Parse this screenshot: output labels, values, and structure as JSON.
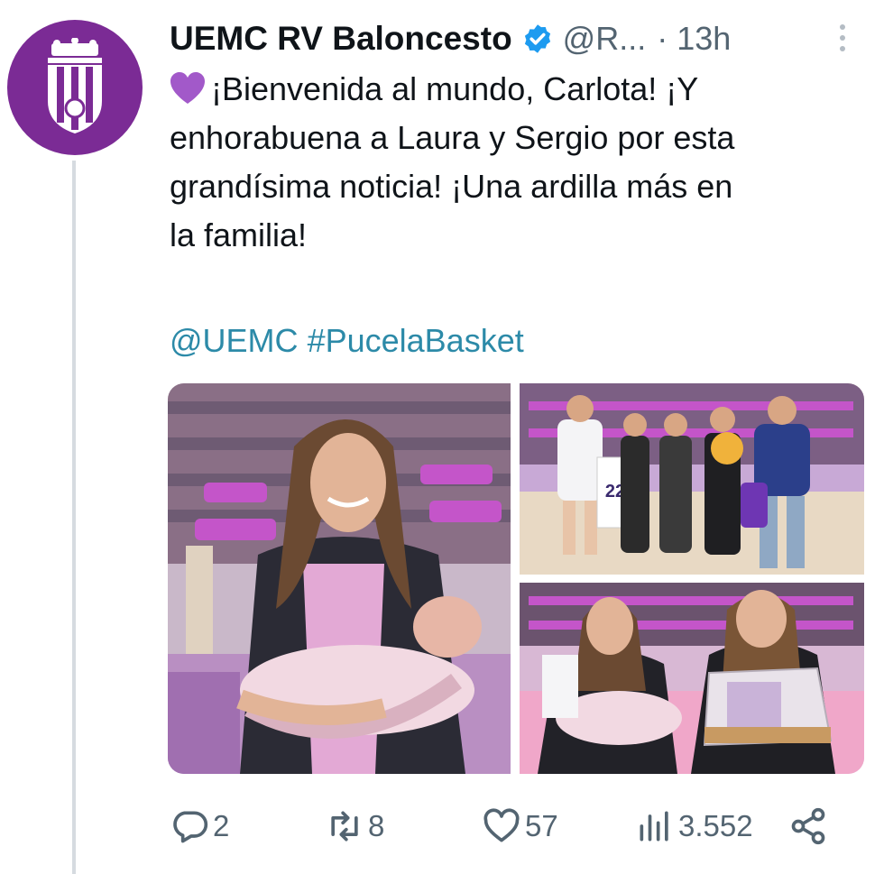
{
  "account": {
    "name": "UEMC RV Baloncesto",
    "handle": "@R...",
    "time": "· 13h"
  },
  "tweet": {
    "emoji": "purple-heart",
    "line1": "¡Bienvenida al mundo, Carlota! ¡Y",
    "line2": "enhorabuena a Laura y Sergio por esta",
    "line3": "grandísima noticia! ¡Una ardilla más en",
    "line4": "la familia!",
    "mention": "@UEMC",
    "hashtag": "#PucelaBasket"
  },
  "stats": {
    "replies": "2",
    "retweets": "8",
    "likes": "57",
    "views": "3.552"
  },
  "photos": {
    "jersey_number": "22"
  },
  "colors": {
    "brand_purple": "#7b2b95",
    "link": "#2c8aa8",
    "muted": "#536471",
    "verified": "#1d9bf0"
  },
  "icons": [
    "club-crest-icon",
    "verified-badge-icon",
    "more-icon",
    "purple-heart-icon",
    "reply-icon",
    "retweet-icon",
    "like-icon",
    "views-icon",
    "share-icon"
  ]
}
